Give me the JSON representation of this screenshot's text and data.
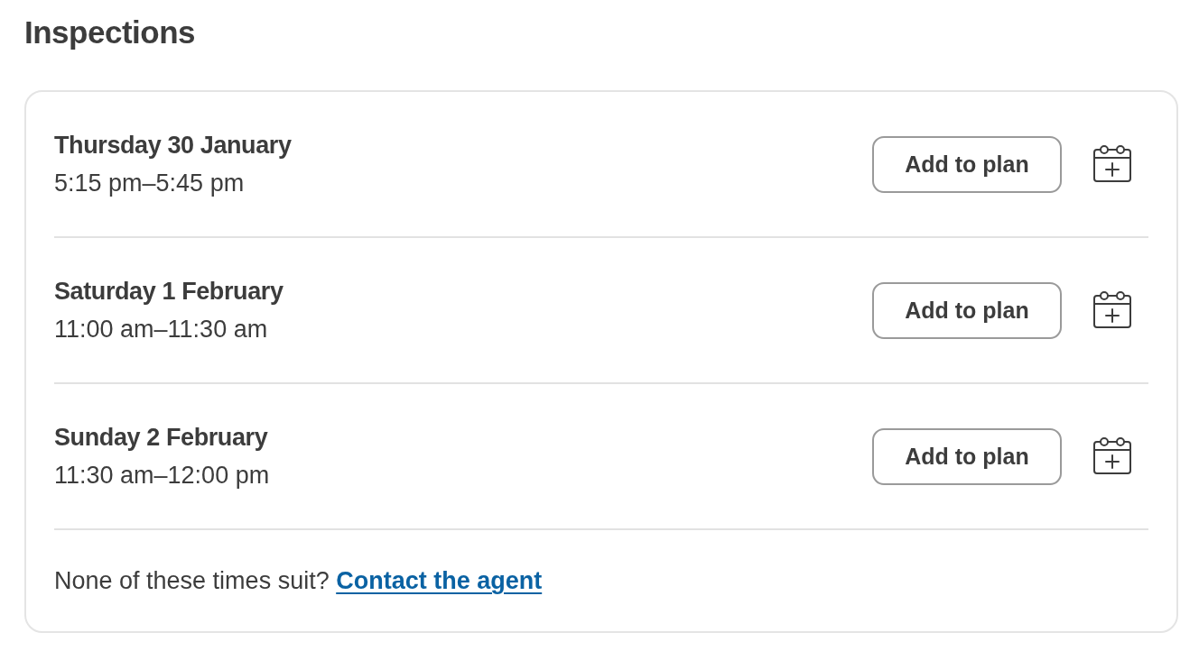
{
  "heading": "Inspections",
  "inspections": [
    {
      "date": "Thursday 30 January",
      "time": "5:15 pm–5:45 pm",
      "button": "Add to plan"
    },
    {
      "date": "Saturday 1 February",
      "time": "11:00 am–11:30 am",
      "button": "Add to plan"
    },
    {
      "date": "Sunday 2 February",
      "time": "11:30 am–12:00 pm",
      "button": "Add to plan"
    }
  ],
  "footer": {
    "text": "None of these times suit?",
    "link": "Contact the agent"
  }
}
